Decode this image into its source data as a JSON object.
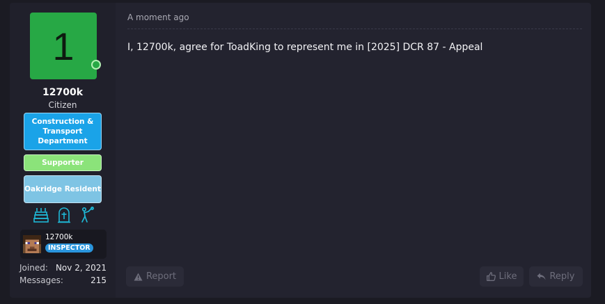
{
  "user": {
    "avatar_letter": "1",
    "avatar_color": "#27a845",
    "username": "12700k",
    "user_title": "Citizen",
    "banners": [
      {
        "text": "Construction & Transport Department",
        "color": "#1aa3e8"
      },
      {
        "text": "Supporter",
        "color": "#8be37a"
      },
      {
        "text": "Oakridge Resident",
        "color": "#7ec4e4"
      }
    ],
    "trophy_icons": [
      "cake-icon",
      "gravestone-icon",
      "worker-icon"
    ],
    "minecraft": {
      "name": "12700k",
      "rank": "INSPECTOR"
    },
    "stats": {
      "joined_label": "Joined:",
      "joined_value": "Nov 2, 2021",
      "messages_label": "Messages:",
      "messages_value": "215"
    }
  },
  "post": {
    "time": "A moment ago",
    "message": "I, 12700k, agree for ToadKing to represent me in [2025] DCR 87 - Appeal",
    "actions": {
      "report_label": "Report",
      "like_label": "Like",
      "reply_label": "Reply"
    }
  }
}
